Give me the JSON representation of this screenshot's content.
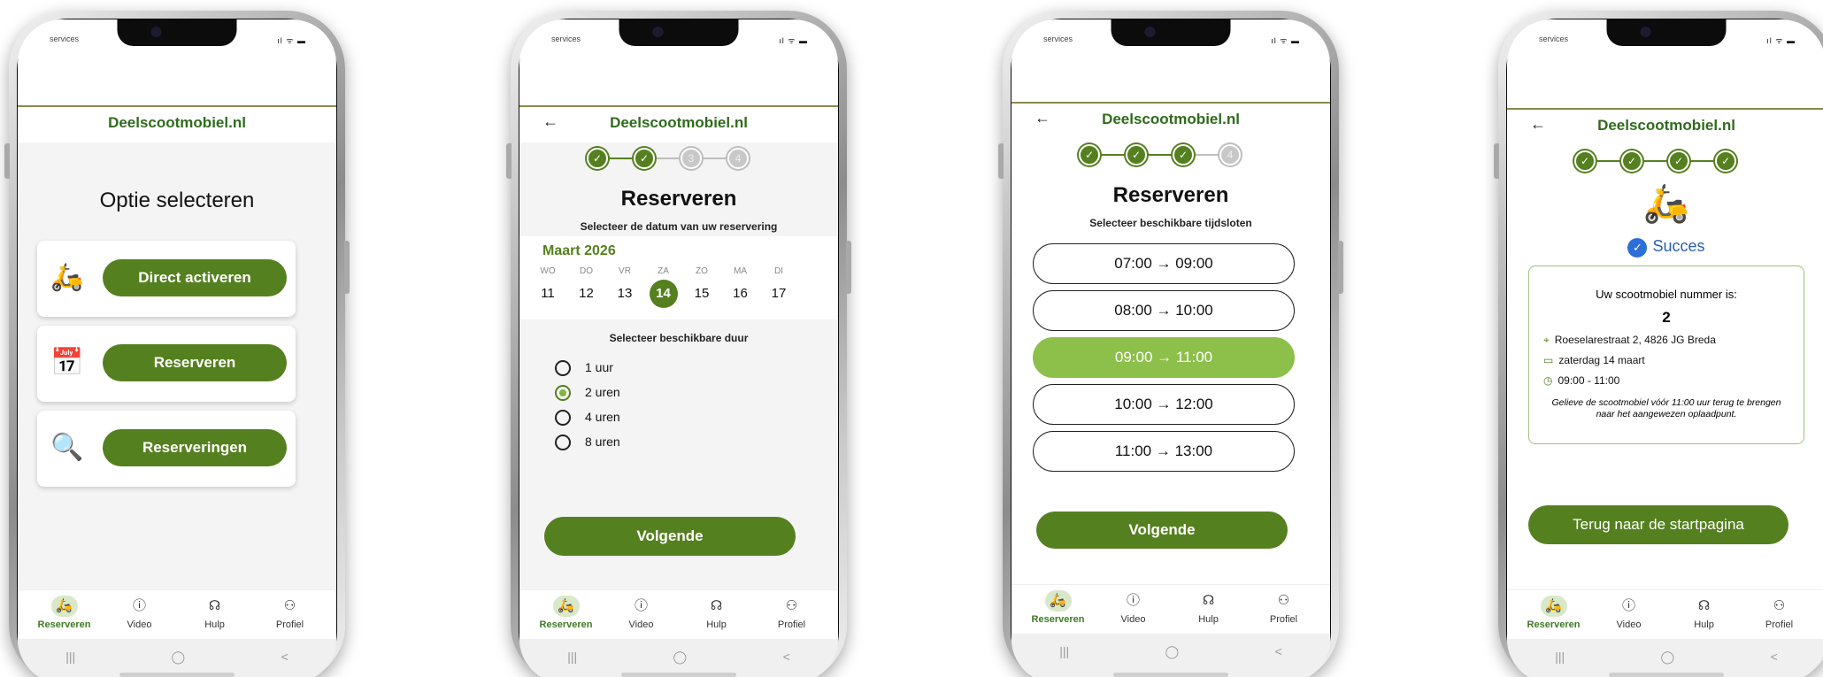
{
  "status": {
    "carrier": "services",
    "icons": "ıl ᯤ ▬"
  },
  "brand": "Deelscootmobiel.nl",
  "tabs": [
    {
      "label": "Reserveren",
      "icon": "scooter-icon"
    },
    {
      "label": "Video",
      "icon": "question-icon"
    },
    {
      "label": "Hulp",
      "icon": "headset-icon"
    },
    {
      "label": "Profiel",
      "icon": "person-icon"
    }
  ],
  "android_nav": {
    "recents": "|||",
    "home": "◯",
    "back": "<"
  },
  "screen1": {
    "title": "Optie selecteren",
    "options": [
      {
        "label": "Direct activeren",
        "icon": "scooter-icon"
      },
      {
        "label": "Reserveren",
        "icon": "calendar-icon"
      },
      {
        "label": "Reserveringen",
        "icon": "search-list-icon"
      }
    ]
  },
  "screen2": {
    "title": "Reserveren",
    "date_prompt": "Selecteer de datum van uw reservering",
    "month": "Maart 2026",
    "days": [
      {
        "dow": "WO",
        "num": "11"
      },
      {
        "dow": "DO",
        "num": "12"
      },
      {
        "dow": "VR",
        "num": "13"
      },
      {
        "dow": "ZA",
        "num": "14",
        "selected": true
      },
      {
        "dow": "ZO",
        "num": "15"
      },
      {
        "dow": "MA",
        "num": "16"
      },
      {
        "dow": "DI",
        "num": "17"
      }
    ],
    "duration_prompt": "Selecteer beschikbare duur",
    "durations": [
      "1 uur",
      "2 uren",
      "4 uren",
      "8 uren"
    ],
    "selected_duration": "2 uren",
    "next": "Volgende",
    "steps_done": 2
  },
  "screen3": {
    "title": "Reserveren",
    "prompt": "Selecteer beschikbare tijdsloten",
    "slots": [
      "07:00  →  09:00",
      "08:00  →  10:00",
      "09:00  →  11:00",
      "10:00  →  12:00",
      "11:00  →  13:00"
    ],
    "selected_slot": "09:00  →  11:00",
    "next": "Volgende",
    "steps_done": 3
  },
  "screen4": {
    "success": "Succes",
    "number_label": "Uw scootmobiel nummer is:",
    "number": "2",
    "address": "Roeselarestraat 2, 4826 JG Breda",
    "date": "zaterdag 14 maart",
    "time": "09:00 - 11:00",
    "note": "Gelieve de scootmobiel vóór 11:00 uur terug te brengen naar het aangewezen oplaadpunt.",
    "home_button": "Terug naar de startpagina",
    "steps_done": 4
  },
  "colors": {
    "brand_green": "#55801f",
    "light_green": "#8dc04a",
    "title_green": "#2f6b1d"
  }
}
